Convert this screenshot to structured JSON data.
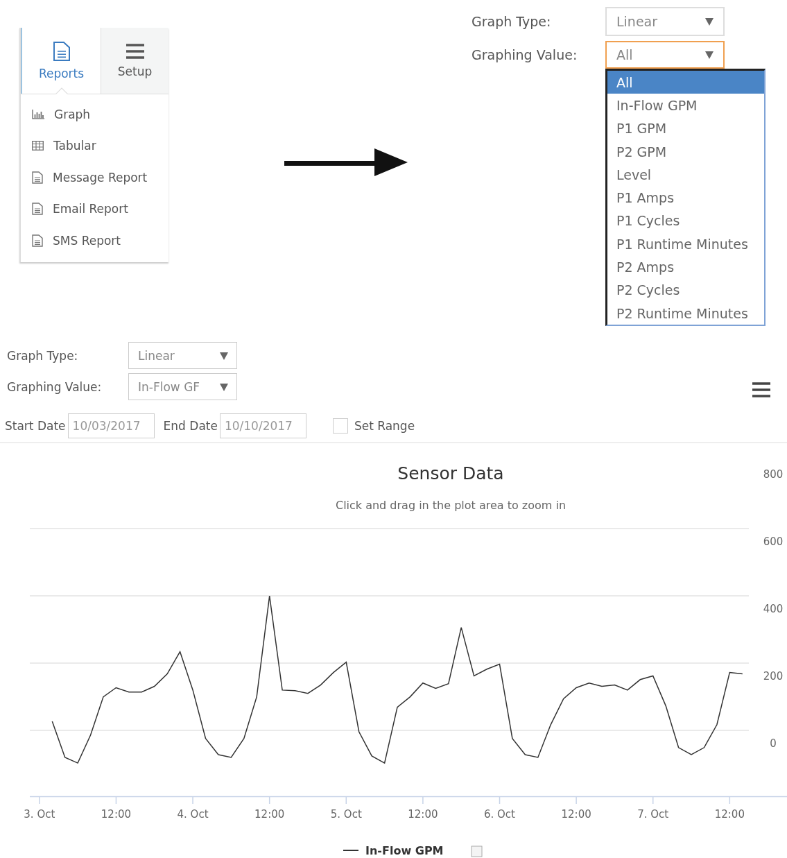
{
  "reports_panel": {
    "tabs": [
      {
        "label": "Reports",
        "selected": true
      },
      {
        "label": "Setup",
        "selected": false
      }
    ],
    "items": [
      {
        "label": "Graph"
      },
      {
        "label": "Tabular"
      },
      {
        "label": "Message Report"
      },
      {
        "label": "Email Report"
      },
      {
        "label": "SMS Report"
      }
    ]
  },
  "settings_form": {
    "fields": [
      {
        "label": "Graph Type:",
        "value": "Linear",
        "focused": false
      },
      {
        "label": "Graphing Value:",
        "value": "All",
        "focused": true
      }
    ],
    "dropdown": {
      "options": [
        {
          "label": "All",
          "selected": true
        },
        {
          "label": "In-Flow GPM",
          "selected": false
        },
        {
          "label": "P1 GPM",
          "selected": false
        },
        {
          "label": "P2 GPM",
          "selected": false
        },
        {
          "label": "Level",
          "selected": false
        },
        {
          "label": "P1 Amps",
          "selected": false
        },
        {
          "label": "P1 Cycles",
          "selected": false
        },
        {
          "label": "P1 Runtime Minutes",
          "selected": false
        },
        {
          "label": "P2 Amps",
          "selected": false
        },
        {
          "label": "P2 Cycles",
          "selected": false
        },
        {
          "label": "P2 Runtime Minutes",
          "selected": false
        }
      ]
    }
  },
  "graph_page": {
    "fields": [
      {
        "label": "Graph Type:",
        "value": "Linear"
      },
      {
        "label": "Graphing Value:",
        "value": "In-Flow GF"
      }
    ],
    "start_date": {
      "label": "Start Date",
      "value": "10/03/2017"
    },
    "end_date": {
      "label": "End Date",
      "value": "10/10/2017"
    },
    "set_range": {
      "label": "Set Range",
      "checked": false
    },
    "chart": {
      "subtitle": "Click and drag in the plot area to zoom in",
      "legend_checked": false,
      "chart_data": {
        "type": "line",
        "title": "Sensor Data",
        "categories": [
          "3. Oct",
          null,
          null,
          null,
          null,
          null,
          "12:00",
          null,
          null,
          null,
          null,
          null,
          "4. Oct",
          null,
          null,
          null,
          null,
          null,
          "12:00",
          null,
          null,
          null,
          null,
          null,
          "5. Oct",
          null,
          null,
          null,
          null,
          null,
          "12:00",
          null,
          null,
          null,
          null,
          null,
          "6. Oct",
          null,
          null,
          null,
          null,
          null,
          "12:00",
          null,
          null,
          null,
          null,
          null,
          "7. Oct",
          null,
          null,
          null,
          null,
          null,
          "12:00",
          null
        ],
        "series": [
          {
            "name": "In-Flow GPM",
            "color": "#333333",
            "values": [
              null,
              64,
              -43,
              -60,
              23,
              137,
              164,
              151,
              151,
              168,
              205,
              271,
              157,
              13,
              -35,
              -43,
              13,
              137,
              437,
              157,
              155,
              147,
              172,
              209,
              240,
              33,
              -39,
              -60,
              106,
              137,
              178,
              162,
              176,
              343,
              199,
              219,
              234,
              13,
              -35,
              -43,
              54,
              131,
              164,
              178,
              168,
              172,
              157,
              188,
              199,
              110,
              -14,
              -35,
              -14,
              54,
              209,
              205
            ]
          }
        ],
        "ylim": [
          -160,
          800
        ],
        "yticks": [
          0,
          200,
          400,
          600,
          800
        ]
      }
    }
  }
}
